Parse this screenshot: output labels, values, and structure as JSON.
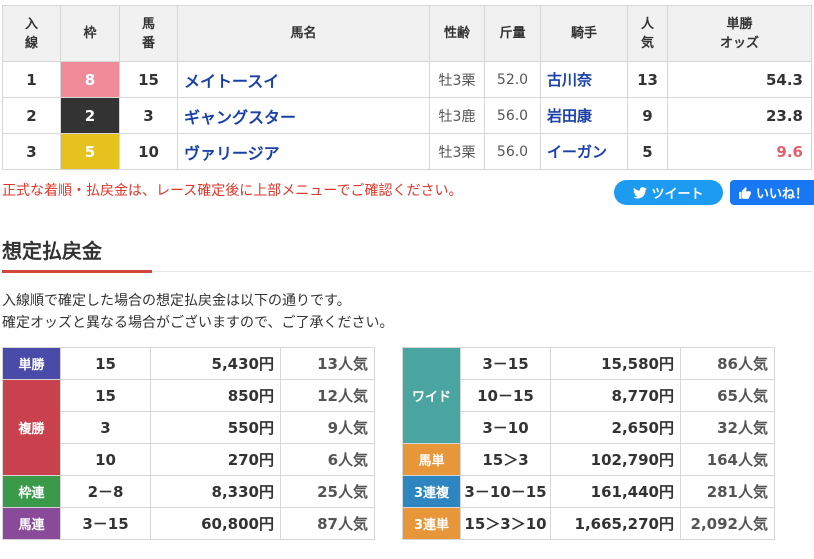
{
  "result": {
    "headers": {
      "finish": [
        "入",
        "線"
      ],
      "waku": "枠",
      "umaban": [
        "馬",
        "番"
      ],
      "horse": "馬名",
      "sexage": "性齢",
      "weight": "斤量",
      "jockey": "騎手",
      "popularity": [
        "人",
        "気"
      ],
      "odds": [
        "単勝",
        "オッズ"
      ]
    },
    "rows": [
      {
        "finish": "1",
        "waku": "8",
        "waku_color": "#f08c9a",
        "waku_text": "#ffffff",
        "umaban": "15",
        "horse": "メイトースイ",
        "sexage": "牡3栗",
        "weight": "52.0",
        "jockey": "古川奈",
        "popularity": "13",
        "odds": "54.3"
      },
      {
        "finish": "2",
        "waku": "2",
        "waku_color": "#333333",
        "waku_text": "#ffffff",
        "umaban": "3",
        "horse": "ギャングスター",
        "sexage": "牡3鹿",
        "weight": "56.0",
        "jockey": "岩田康",
        "popularity": "9",
        "odds": "23.8"
      },
      {
        "finish": "3",
        "waku": "5",
        "waku_color": "#e6c21e",
        "waku_text": "#ffffff",
        "umaban": "10",
        "horse": "ヴァリージア",
        "sexage": "牡3栗",
        "weight": "56.0",
        "jockey": "イーガン",
        "popularity": "5",
        "odds": "9.6"
      }
    ]
  },
  "notice": "正式な着順・払戻金は、レース確定後に上部メニューでご確認ください。",
  "share": {
    "tweet": "ツイート",
    "like": "いいね！"
  },
  "section_title": "想定払戻金",
  "description": [
    "入線順で確定した場合の想定払戻金は以下の通りです。",
    "確定オッズと異なる場合がございますので、ご了承ください。"
  ],
  "payout_left": [
    {
      "label": "単勝",
      "color": "#4a4aa8",
      "rows": [
        {
          "combo": "15",
          "amount": "5,430円",
          "pop": "13人気"
        }
      ]
    },
    {
      "label": "複勝",
      "color": "#c8414c",
      "rows": [
        {
          "combo": "15",
          "amount": "850円",
          "pop": "12人気"
        },
        {
          "combo": "3",
          "amount": "550円",
          "pop": "9人気"
        },
        {
          "combo": "10",
          "amount": "270円",
          "pop": "6人気"
        }
      ]
    },
    {
      "label": "枠連",
      "color": "#3a9a4a",
      "rows": [
        {
          "combo": "2－8",
          "amount": "8,330円",
          "pop": "25人気"
        }
      ]
    },
    {
      "label": "馬連",
      "color": "#8a4a9a",
      "rows": [
        {
          "combo": "3－15",
          "amount": "60,800円",
          "pop": "87人気"
        }
      ]
    }
  ],
  "payout_right": [
    {
      "label": "ワイド",
      "color": "#4aa5a0",
      "rows": [
        {
          "combo": "3－15",
          "amount": "15,580円",
          "pop": "86人気"
        },
        {
          "combo": "10－15",
          "amount": "8,770円",
          "pop": "65人気"
        },
        {
          "combo": "3－10",
          "amount": "2,650円",
          "pop": "32人気"
        }
      ]
    },
    {
      "label": "馬単",
      "color": "#e8963a",
      "rows": [
        {
          "combo": "15＞3",
          "amount": "102,790円",
          "pop": "164人気"
        }
      ]
    },
    {
      "label": "3連複",
      "color": "#2e86c1",
      "rows": [
        {
          "combo": "3－10－15",
          "amount": "161,440円",
          "pop": "281人気"
        }
      ]
    },
    {
      "label": "3連単",
      "color": "#e8963a",
      "rows": [
        {
          "combo": "15＞3＞10",
          "amount": "1,665,270円",
          "pop": "2,092人気"
        }
      ]
    }
  ]
}
